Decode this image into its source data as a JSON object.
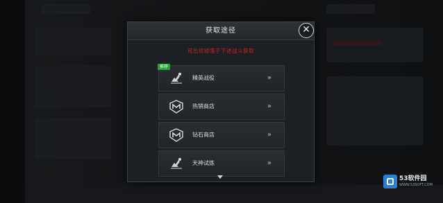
{
  "dialog": {
    "title": "获取途径",
    "subtitle": "可出现掉落于下述战斗获取",
    "close_symbol": "✕",
    "scroll_indicator": "▼",
    "items": [
      {
        "label": "精英战役",
        "badge": "推荐",
        "icon": "battle-hand-icon",
        "arrow": "»"
      },
      {
        "label": "热销商店",
        "badge": "",
        "icon": "shop-emblem-icon",
        "arrow": "»"
      },
      {
        "label": "钻石商店",
        "badge": "",
        "icon": "shop-emblem-icon",
        "arrow": "»"
      },
      {
        "label": "天神试炼",
        "badge": "",
        "icon": "battle-hand-icon",
        "arrow": "»"
      }
    ]
  },
  "watermark": {
    "name": "53软件园",
    "url": "WWW.53SOFT.COM"
  },
  "colors": {
    "subtitle_red": "#c0262a",
    "badge_green": "#2f9e3a",
    "dialog_bg": "#1d2024"
  }
}
